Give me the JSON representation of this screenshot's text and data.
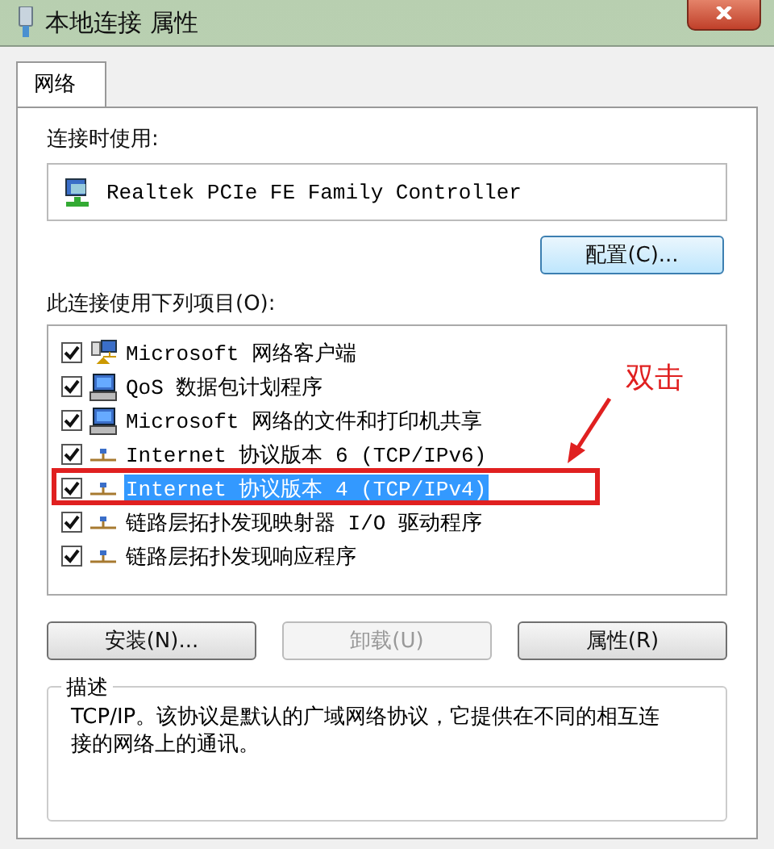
{
  "window": {
    "title": "本地连接 属性"
  },
  "tabs": [
    {
      "label": "网络",
      "selected": true
    }
  ],
  "connect_using": {
    "label": "连接时使用:",
    "adapter": "Realtek PCIe FE Family Controller"
  },
  "configure_button": "配置(C)...",
  "items_label": "此连接使用下列项目(O):",
  "items": [
    {
      "kind": "client",
      "label": "Microsoft 网络客户端",
      "checked": true,
      "selected": false
    },
    {
      "kind": "service",
      "label": "QoS 数据包计划程序",
      "checked": true,
      "selected": false
    },
    {
      "kind": "service",
      "label": "Microsoft 网络的文件和打印机共享",
      "checked": true,
      "selected": false
    },
    {
      "kind": "protocol",
      "label": "Internet 协议版本 6 (TCP/IPv6)",
      "checked": true,
      "selected": false
    },
    {
      "kind": "protocol",
      "label": "Internet 协议版本 4 (TCP/IPv4)",
      "checked": true,
      "selected": true
    },
    {
      "kind": "protocol",
      "label": "链路层拓扑发现映射器 I/O 驱动程序",
      "checked": true,
      "selected": false
    },
    {
      "kind": "protocol",
      "label": "链路层拓扑发现响应程序",
      "checked": true,
      "selected": false
    }
  ],
  "buttons": [
    {
      "label": "安装(N)...",
      "disabled": false
    },
    {
      "label": "卸载(U)",
      "disabled": true
    },
    {
      "label": "属性(R)",
      "disabled": false
    }
  ],
  "description": {
    "legend": "描述",
    "text": "TCP/IP。该协议是默认的广域网络协议，它提供在不同的相互连接的网络上的通讯。"
  },
  "annotation": {
    "text": "双击"
  }
}
